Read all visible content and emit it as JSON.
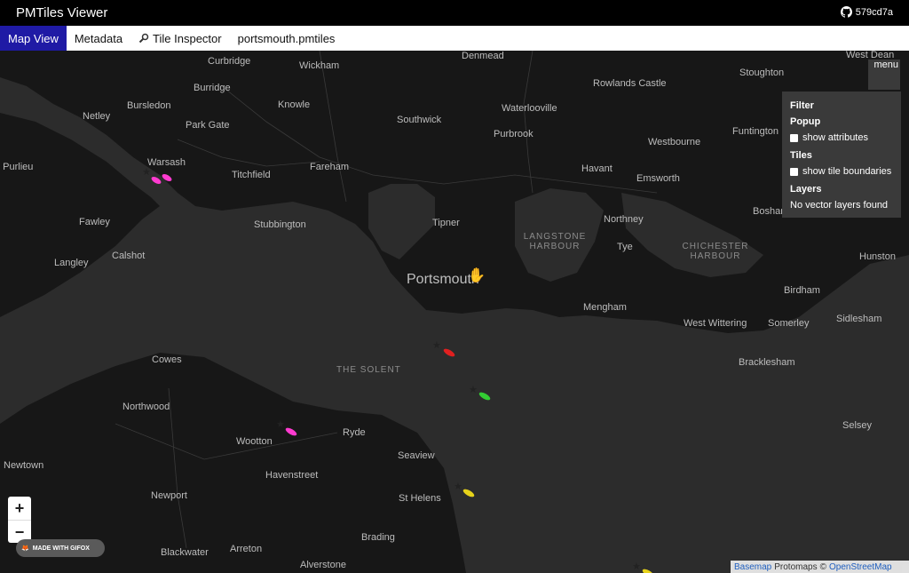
{
  "app": {
    "title": "PMTiles Viewer",
    "github_label": "579cd7a",
    "github_icon": "github-icon"
  },
  "tabs": [
    {
      "label": "Map View"
    },
    {
      "label": "Metadata"
    },
    {
      "label": "Tile Inspector",
      "icon": "search-icon"
    },
    {
      "label": "portsmouth.pmtiles"
    }
  ],
  "panel": {
    "menu_label": "menu",
    "filter_label": "Filter",
    "popup_heading": "Popup",
    "show_attributes": "show attributes",
    "tiles_heading": "Tiles",
    "show_tile_boundaries": "show tile boundaries",
    "layers_heading": "Layers",
    "layers_message": "No vector layers found"
  },
  "zoom": {
    "in": "+",
    "out": "−"
  },
  "gifox_badge": "MADE WITH GIFOX",
  "attribution": {
    "basemap": "Basemap",
    "protomaps": "Protomaps",
    "copyright": "©",
    "osm": "OpenStreetMap"
  },
  "map_labels": {
    "denmead": "Denmead",
    "west_dean": "West Dean",
    "curbridge": "Curbridge",
    "wickham": "Wickham",
    "stoughton": "Stoughton",
    "burridge": "Burridge",
    "rowlands_castle": "Rowlands Castle",
    "bursledon": "Bursledon",
    "knowle": "Knowle",
    "waterlooville": "Waterlooville",
    "netley": "Netley",
    "southwick": "Southwick",
    "park_gate": "Park Gate",
    "purbrook": "Purbrook",
    "funtington": "Funtington",
    "westbourne": "Westbourne",
    "warsash": "Warsash",
    "fareham": "Fareham",
    "havant": "Havant",
    "purlieu": "n Purlieu",
    "titchfield": "Titchfield",
    "emsworth": "Emsworth",
    "fawley": "Fawley",
    "tipner": "Tipner",
    "northney": "Northney",
    "bosham": "Boshar",
    "stubbington": "Stubbington",
    "langstone": "LANGSTONE HARBOUR",
    "chichester": "CHICHESTER HARBOUR",
    "tye": "Tye",
    "langley": "Langley",
    "calshot": "Calshot",
    "hunston": "Hunston",
    "portsmouth": "Portsmouth",
    "birdham": "Birdham",
    "mengham": "Mengham",
    "sidlesham": "Sidlesham",
    "west_wittering": "West Wittering",
    "somerley": "Somerley",
    "cowes": "Cowes",
    "solent": "THE SOLENT",
    "bracklesham": "Bracklesham",
    "northwood": "Northwood",
    "selsey": "Selsey",
    "ryde": "Ryde",
    "wootton": "Wootton",
    "seaview": "Seaview",
    "newtown": "Newtown",
    "havenstreet": "Havenstreet",
    "st_helens": "St Helens",
    "newport": "Newport",
    "brading": "Brading",
    "blackwater": "Blackwater",
    "arreton": "Arreton",
    "alverstone": "Alverstone"
  },
  "vessels": [
    {
      "color": "#ff3bd0"
    },
    {
      "color": "#ff3bd0"
    },
    {
      "color": "#e02020"
    },
    {
      "color": "#33cc33"
    },
    {
      "color": "#ff3bd0"
    },
    {
      "color": "#e6d21a"
    },
    {
      "color": "#e6d21a"
    }
  ]
}
